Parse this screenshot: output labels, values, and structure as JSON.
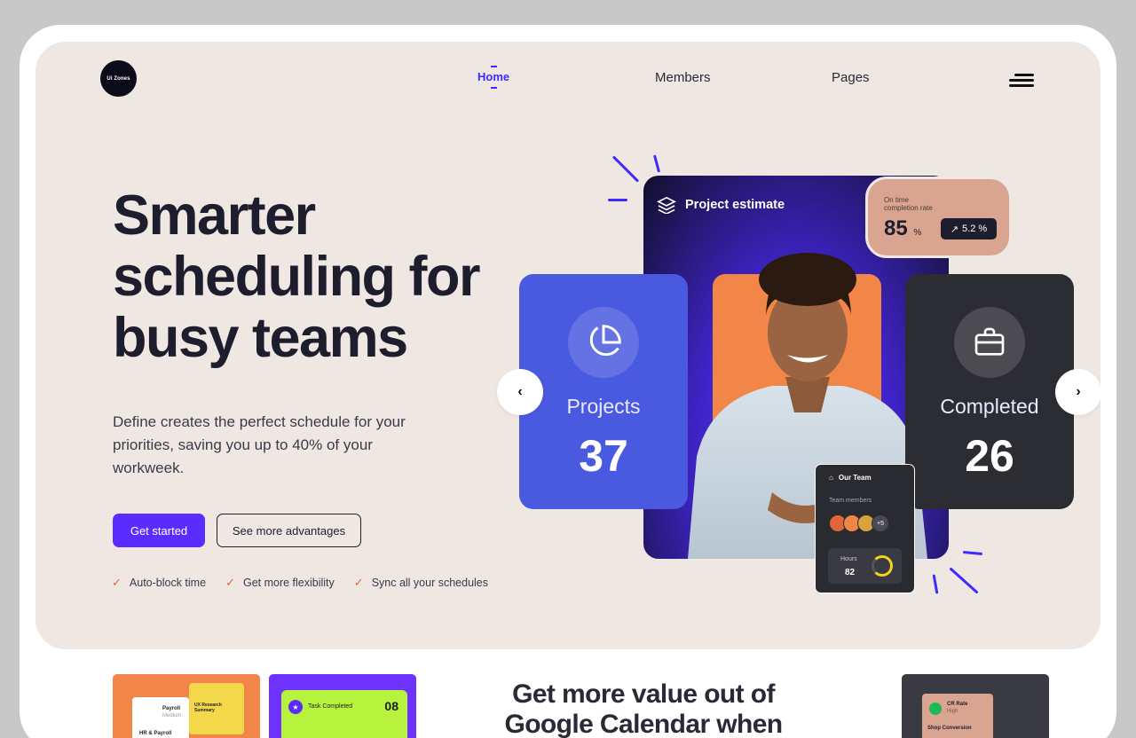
{
  "brand": {
    "logo_text": "Ui Zones"
  },
  "nav": {
    "items": [
      "Home",
      "Members",
      "Pages"
    ],
    "active": "Home"
  },
  "hero": {
    "title": "Smarter\nscheduling for\nbusy teams",
    "description": "Define creates the perfect schedule for your priorities, saving you up to 40% of your workweek.",
    "primary_button": "Get started",
    "secondary_button": "See more advantages",
    "checks": [
      "Auto-block time",
      "Get more flexibility",
      "Sync all your schedules"
    ]
  },
  "showcase": {
    "project_estimate_label": "Project estimate",
    "rate": {
      "label": "On time\ncompletion rate",
      "value": "85",
      "unit": "%",
      "change": "5.2 %"
    },
    "projects": {
      "label": "Projects",
      "value": "37"
    },
    "completed": {
      "label": "Completed",
      "value": "26"
    },
    "team": {
      "title": "Our Team",
      "subtitle": "Team members",
      "extra_members": "+5",
      "hours_label": "Hours",
      "hours_value": "82"
    }
  },
  "below": {
    "section_title": "Get more value out of\nGoogle Calendar when",
    "card1": {
      "payroll": "Payroll",
      "medium": "Medium",
      "hr": "HR & Payroll",
      "ux": "UX Research\nSummary"
    },
    "card2": {
      "task_label": "Task Completed",
      "task_value": "08"
    },
    "card3": {
      "cr_rate": "CR Rate",
      "high": "High",
      "shop": "Shop Conversion"
    }
  },
  "colors": {
    "accent": "#5b2cff",
    "nav_active": "#3e2bff",
    "hero_bg": "#efe7e2",
    "projects_card": "#4a5ae0",
    "completed_card": "#2c2c33",
    "orange": "#f28548"
  },
  "icons": [
    "logo-icon",
    "menu-icon",
    "layers-icon",
    "pie-chart-icon",
    "briefcase-icon",
    "chevron-left-icon",
    "chevron-right-icon",
    "trend-up-icon",
    "team-icon",
    "check-icon"
  ]
}
